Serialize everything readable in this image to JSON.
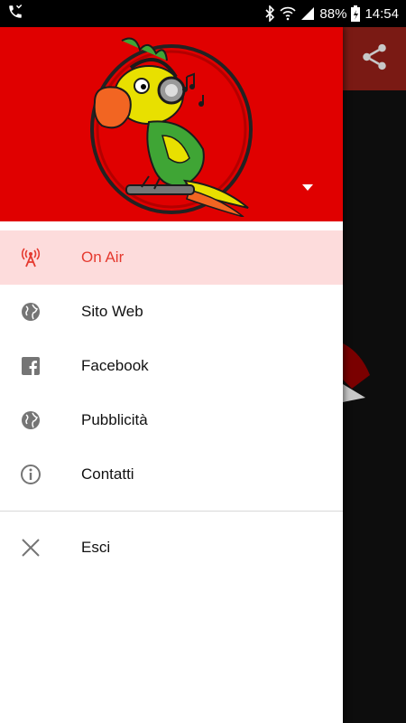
{
  "status_bar": {
    "battery_percent": "88%",
    "time": "14:54",
    "icons": [
      "missed-call-icon",
      "bluetooth-icon",
      "wifi-icon",
      "signal-icon",
      "battery-charging-icon"
    ]
  },
  "app": {
    "share_icon": "share-icon"
  },
  "drawer": {
    "header_color": "#e00000",
    "logo": "parrot-headphones-logo",
    "menu": [
      {
        "label": "On Air",
        "icon": "radio-tower-icon",
        "active": true
      },
      {
        "label": "Sito Web",
        "icon": "globe-icon",
        "active": false
      },
      {
        "label": "Facebook",
        "icon": "facebook-icon",
        "active": false
      },
      {
        "label": "Pubblicità",
        "icon": "globe-icon",
        "active": false
      },
      {
        "label": "Contatti",
        "icon": "info-icon",
        "active": false
      }
    ],
    "secondary_menu": [
      {
        "label": "Esci",
        "icon": "close-icon"
      }
    ],
    "accent_color": "#e53a2f"
  }
}
